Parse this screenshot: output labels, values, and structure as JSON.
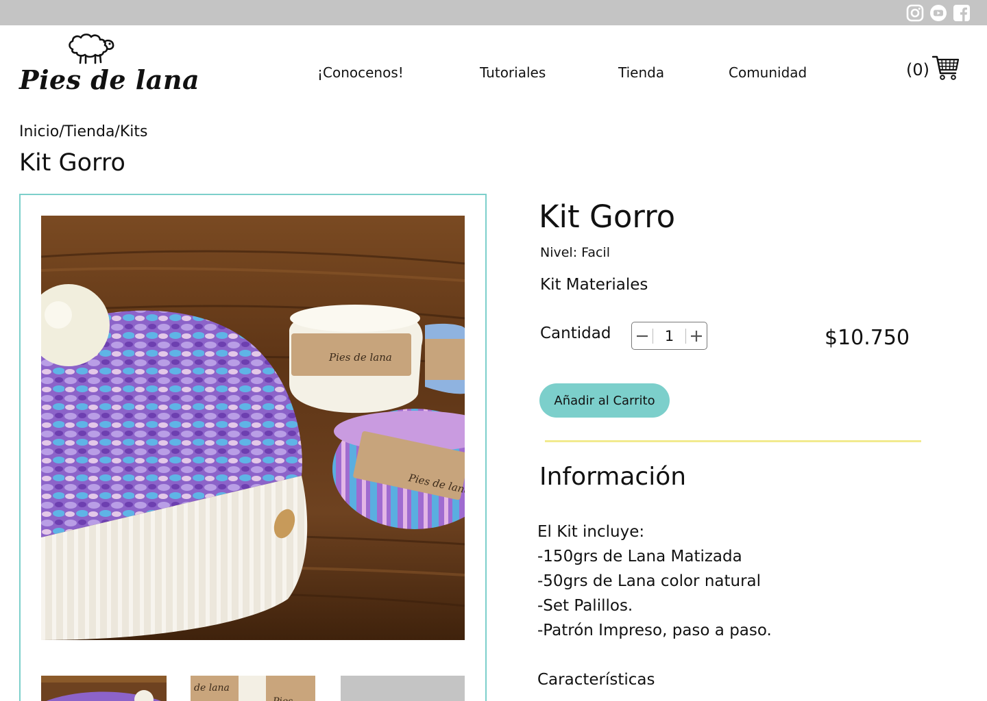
{
  "topbar": {
    "social": [
      {
        "name": "instagram-icon"
      },
      {
        "name": "youtube-icon"
      },
      {
        "name": "facebook-icon"
      }
    ]
  },
  "brand": {
    "name": "Pies de lana",
    "logo_icon": "sheep-icon"
  },
  "nav": {
    "items": [
      {
        "label": "¡Conocenos!"
      },
      {
        "label": "Tutoriales"
      },
      {
        "label": "Tienda"
      },
      {
        "label": "Comunidad"
      }
    ]
  },
  "cart": {
    "count_label": "(0)",
    "icon": "shopping-cart-icon"
  },
  "breadcrumb": "Inicio/Tienda/Kits",
  "page_title": "Kit Gorro",
  "product": {
    "title": "Kit Gorro",
    "level": "Nivel: Facil",
    "kit_label": "Kit Materiales",
    "quantity_label": "Cantidad",
    "quantity": "1",
    "price": "$10.750",
    "add_to_cart": "Añadir al Carrito"
  },
  "info": {
    "title": "Información",
    "lines": [
      "El Kit incluye:",
      "-150grs de Lana Matizada",
      "-50grs de Lana color natural",
      "-Set Palillos.",
      "-Patrón Impreso, paso a paso.",
      "",
      "Características"
    ]
  },
  "colors": {
    "accent": "#7ccfcb",
    "divider": "#f2ea8e",
    "topbar": "#c4c4c4"
  }
}
